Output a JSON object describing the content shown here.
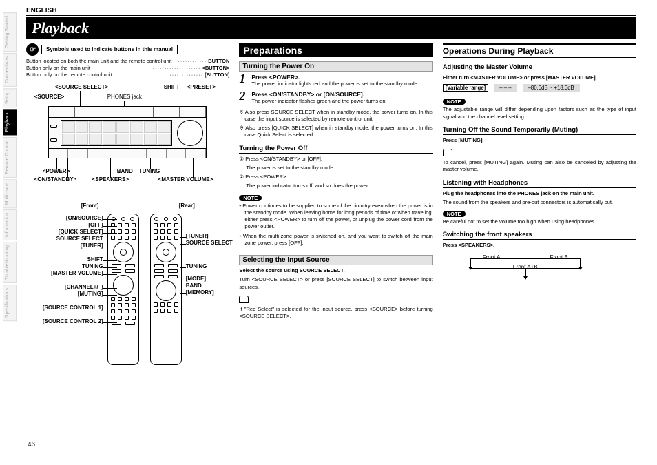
{
  "meta": {
    "language": "ENGLISH",
    "page_title": "Playback",
    "page_number": "46"
  },
  "sidebar": {
    "tabs": [
      "Getting Started",
      "Connections",
      "Setup",
      "Playback",
      "Remote Control",
      "Multi-zone",
      "Information",
      "Troubleshooting",
      "Specifications"
    ],
    "active_index": 3
  },
  "legend": {
    "title": "Symbols used to indicate buttons in this manual",
    "rows": [
      {
        "text": "Button located on both the main unit and the remote control unit",
        "symbol": "BUTTON"
      },
      {
        "text": "Button only on the main unit",
        "symbol": "<BUTTON>"
      },
      {
        "text": "Button only on the remote control unit",
        "symbol": "[BUTTON]"
      }
    ]
  },
  "main_unit_labels": {
    "source_select": "<SOURCE SELECT>",
    "source": "<SOURCE>",
    "phones_jack": "PHONES jack",
    "shift": "SHIFT",
    "preset": "<PRESET>",
    "power": "<POWER>",
    "on_standby": "<ON/STANDBY>",
    "band": "BAND",
    "speakers": "<SPEAKERS>",
    "tuning": "TUNING",
    "master_volume": "<MASTER VOLUME>"
  },
  "remote_headers": {
    "front": "[Front]",
    "rear": "[Rear]"
  },
  "remote_front_labels": [
    "[ON/SOURCE]",
    "[OFF]",
    "[QUICK SELECT]",
    "SOURCE SELECT",
    "[TUNER]",
    "SHIFT",
    "TUNING",
    "[MASTER VOLUME]",
    "[CHANNEL+/–]",
    "[MUTING]",
    "[SOURCE CONTROL 1]",
    "[SOURCE CONTROL 2]"
  ],
  "remote_rear_labels": [
    "[TUNER]",
    "SOURCE SELECT",
    "TUNING",
    "[MODE]",
    "BAND",
    "[MEMORY]"
  ],
  "col2": {
    "section": "Preparations",
    "sub1": "Turning the Power On",
    "step1_title": "Press <POWER>.",
    "step1_body": "The power indicator lights red and the power is set to the standby mode.",
    "step2_title": "Press <ON/STANDBY> or [ON/SOURCE].",
    "step2_body": "The power indicator flashes green and the power turns on.",
    "step2_note1": "※ Also press SOURCE SELECT when in standby mode, the power turns on. In this case the input source is selected by remote control unit.",
    "step2_note2": "※ Also press [QUICK SELECT] when in standby mode, the power turns on. In this case Quick Select is selected.",
    "sub_off": "Turning the Power Off",
    "off_1": "① Press <ON/STANDBY> or [OFF].",
    "off_1b": "The power is set to the standby mode.",
    "off_2": "② Press <POWER>.",
    "off_2b": "The power indicator turns off, and so does the power.",
    "note_label": "NOTE",
    "off_note_a": "• Power continues to be supplied to some of the circuitry even when the power is in the standby mode. When leaving home for long periods of time or when traveling, either press <POWER> to turn off the power, or unplug the power cord from the power outlet.",
    "off_note_b": "• When the multi-zone power is switched on, and you want to switch off the main zone power, press [OFF].",
    "sub2": "Selecting the Input Source",
    "sel_title": "Select the source using SOURCE SELECT.",
    "sel_body": "Turn <SOURCE SELECT> or press [SOURCE SELECT] to switch between input sources.",
    "sel_tip": "If \"Rec Select\" is selected for the input source, press <SOURCE> before turning <SOURCE SELECT>."
  },
  "col3": {
    "section": "Operations During Playback",
    "adj_head": "Adjusting the Master Volume",
    "adj_body": "Either turn <MASTER VOLUME> or press [MASTER VOLUME].",
    "range_label": "[Variable range]",
    "range_dashes": "– – –",
    "range_val": "–80.0dB ~ +18.0dB",
    "note_label": "NOTE",
    "adj_note": "The adjustable range will differ depending upon factors such as the type of input signal and the channel level setting.",
    "mute_head": "Turning Off the Sound Temporarily (Muting)",
    "mute_body": "Press [MUTING].",
    "mute_tip": "To cancel, press [MUTING] again. Muting can also be canceled by adjusting the master volume.",
    "hp_head": "Listening with Headphones",
    "hp_body": "Plug the headphones into the PHONES jack on the main unit.",
    "hp_detail": "The sound from the speakers and pre-out connectors is automatically cut.",
    "hp_note": "Be careful not to set the volume too high when using headphones.",
    "spk_head": "Switching the front speakers",
    "spk_body": "Press <SPEAKERS>.",
    "spk_labels": {
      "a": "Front A",
      "b": "Front B",
      "ab": "Front A+B"
    }
  }
}
